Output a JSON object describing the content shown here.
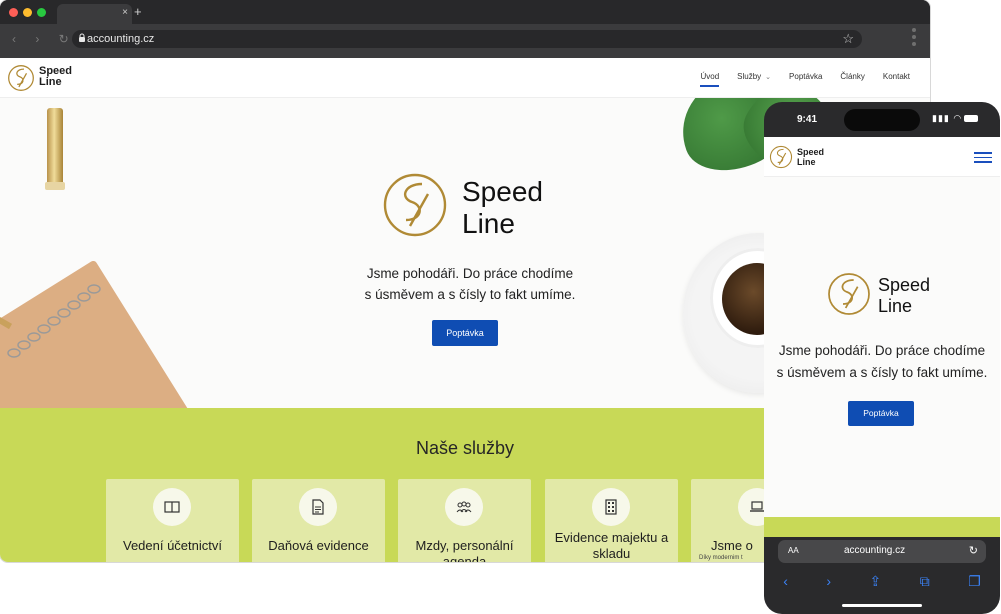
{
  "browser": {
    "url": "accounting.cz",
    "tab_close": "×",
    "new_tab": "+",
    "nav_glyphs": "‹ › ↻",
    "star": "☆"
  },
  "site": {
    "logo_line1": "Speed",
    "logo_line2": "Line",
    "nav": [
      {
        "label": "Úvod"
      },
      {
        "label": "Služby"
      },
      {
        "label": "Poptávka"
      },
      {
        "label": "Články"
      },
      {
        "label": "Kontakt"
      }
    ],
    "nav_chevron": "⌄",
    "hero": {
      "tagline_line1": "Jsme pohodáři. Do práce chodíme",
      "tagline_line2": "s úsměvem a s čísly to fakt umíme.",
      "cta": "Poptávka"
    },
    "services": {
      "title": "Naše služby",
      "cards": [
        {
          "label": "Vedení účetnictví",
          "icon": "book-icon"
        },
        {
          "label": "Daňová evidence",
          "icon": "document-icon"
        },
        {
          "label": "Mzdy, personální agenda",
          "icon": "people-icon"
        },
        {
          "label": "Evidence majektu a skladu",
          "icon": "building-icon"
        },
        {
          "label": "Jsme o",
          "sub": "Díky modernim t",
          "icon": "laptop-icon"
        }
      ]
    }
  },
  "phone": {
    "time": "9:41",
    "status": "▮▮▮ ◠",
    "url": "accounting.cz",
    "aa": "AA",
    "reload": "↻",
    "toolbar": [
      "‹",
      "›",
      "⇪",
      "⧉",
      "❐"
    ]
  },
  "colors": {
    "brand_blue": "#0f4db3",
    "gold": "#b08a35",
    "lime": "#c8d957"
  }
}
